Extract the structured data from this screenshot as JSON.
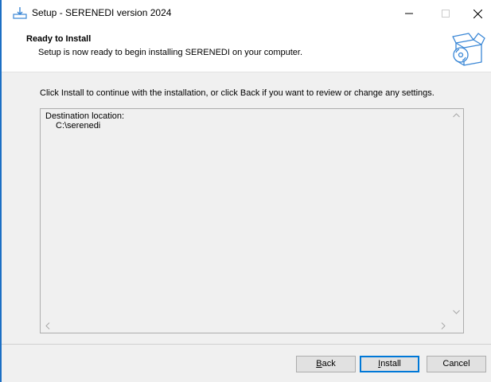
{
  "window": {
    "title": "Setup - SERENEDI version 2024",
    "minimize_icon": "minimize-icon",
    "maximize_icon": "maximize-icon",
    "close_icon": "close-icon"
  },
  "header": {
    "title": "Ready to Install",
    "subtitle": "Setup is now ready to begin installing SERENEDI on your computer.",
    "image_icon": "box-with-disc-icon"
  },
  "main": {
    "instruction": "Click Install to continue with the installation, or click Back if you want to review or change any settings.",
    "memo": {
      "line1": "Destination location:",
      "line2": "C:\\serenedi"
    }
  },
  "buttons": {
    "back": {
      "accel": "B",
      "rest": "ack"
    },
    "install": {
      "accel": "I",
      "rest": "nstall"
    },
    "cancel": "Cancel"
  },
  "colors": {
    "accent": "#0078d7",
    "window_border": "#1c6fc4",
    "panel_bg": "#f0f0f0",
    "icon_blue": "#3a87d6"
  }
}
